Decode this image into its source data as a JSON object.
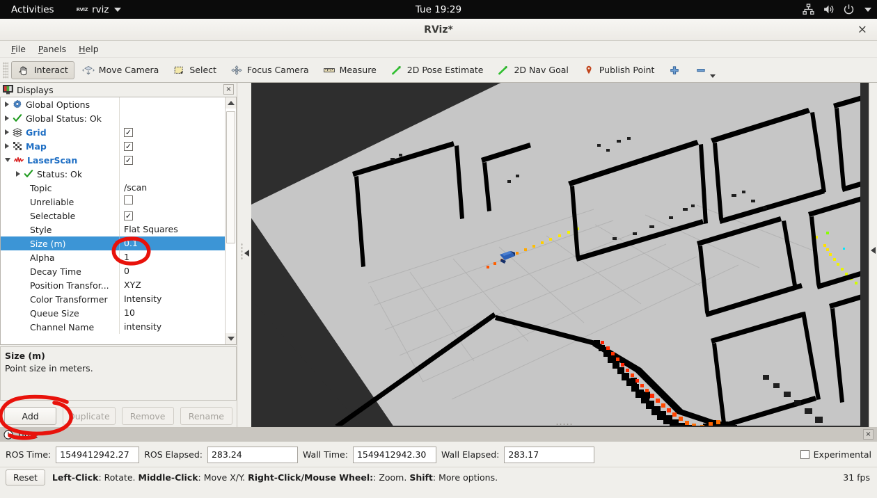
{
  "desktop": {
    "activities_label": "Activities",
    "app_icon_label": "RVIZ",
    "app_name": "rviz",
    "clock": "Tue 19:29",
    "tray_icons": [
      "network-icon",
      "volume-icon",
      "power-icon",
      "chevron-down-icon"
    ]
  },
  "window": {
    "title": "RViz*",
    "close_label": "×"
  },
  "menubar": {
    "items": [
      {
        "label": "File",
        "accel": "F"
      },
      {
        "label": "Panels",
        "accel": "P"
      },
      {
        "label": "Help",
        "accel": "H"
      }
    ]
  },
  "toolbar": {
    "items": [
      {
        "label": "Interact",
        "icon": "hand-cursor-icon",
        "active": true
      },
      {
        "label": "Move Camera",
        "icon": "move-camera-icon",
        "active": false
      },
      {
        "label": "Select",
        "icon": "select-box-icon",
        "active": false
      },
      {
        "label": "Focus Camera",
        "icon": "focus-camera-icon",
        "active": false
      },
      {
        "label": "Measure",
        "icon": "ruler-icon",
        "active": false
      },
      {
        "label": "2D Pose Estimate",
        "icon": "pose-arrow-icon",
        "active": false
      },
      {
        "label": "2D Nav Goal",
        "icon": "nav-goal-icon",
        "active": false
      },
      {
        "label": "Publish Point",
        "icon": "map-pin-icon",
        "active": false
      }
    ],
    "add_tool_icon": "plus-icon",
    "remove_tool_icon": "minus-icon",
    "remove_tool_dropdown_icon": "chevron-down-icon"
  },
  "displays_panel": {
    "title": "Displays",
    "icon": "displays-monitor-icon",
    "close_label": "×",
    "tree": [
      {
        "kind": "item",
        "indent": 0,
        "expander": "right",
        "icon": "gear-icon",
        "label": "Global Options",
        "style": "plain",
        "checkbox": null
      },
      {
        "kind": "item",
        "indent": 0,
        "expander": "right",
        "icon": "check-icon",
        "label": "Global Status: Ok",
        "style": "plain",
        "checkbox": null
      },
      {
        "kind": "item",
        "indent": 0,
        "expander": "right",
        "icon": "grid-icon",
        "label": "Grid",
        "style": "blue",
        "checkbox": true
      },
      {
        "kind": "item",
        "indent": 0,
        "expander": "right",
        "icon": "map-icon",
        "label": "Map",
        "style": "blue",
        "checkbox": true
      },
      {
        "kind": "item",
        "indent": 0,
        "expander": "down",
        "icon": "laserscan-icon",
        "label": "LaserScan",
        "style": "blue",
        "checkbox": true
      },
      {
        "kind": "item",
        "indent": 1,
        "expander": "right",
        "icon": "check-icon",
        "label": "Status: Ok",
        "style": "plain",
        "checkbox": null
      },
      {
        "kind": "prop",
        "label": "Topic",
        "value": "/scan",
        "value_type": "text"
      },
      {
        "kind": "prop",
        "label": "Unreliable",
        "value": false,
        "value_type": "checkbox"
      },
      {
        "kind": "prop",
        "label": "Selectable",
        "value": true,
        "value_type": "checkbox"
      },
      {
        "kind": "prop",
        "label": "Style",
        "value": "Flat Squares",
        "value_type": "text"
      },
      {
        "kind": "prop",
        "label": "Size (m)",
        "value": "0.1",
        "value_type": "text",
        "selected": true
      },
      {
        "kind": "prop",
        "label": "Alpha",
        "value": "1",
        "value_type": "text"
      },
      {
        "kind": "prop",
        "label": "Decay Time",
        "value": "0",
        "value_type": "text"
      },
      {
        "kind": "prop",
        "label": "Position Transfor...",
        "value": "XYZ",
        "value_type": "text"
      },
      {
        "kind": "prop",
        "label": "Color Transformer",
        "value": "Intensity",
        "value_type": "text"
      },
      {
        "kind": "prop",
        "label": "Queue Size",
        "value": "10",
        "value_type": "text"
      },
      {
        "kind": "prop",
        "label": "Channel Name",
        "value": "intensity",
        "value_type": "text"
      }
    ],
    "description": {
      "title": "Size (m)",
      "text": "Point size in meters."
    },
    "buttons": [
      {
        "label": "Add",
        "enabled": true
      },
      {
        "label": "Duplicate",
        "enabled": false
      },
      {
        "label": "Remove",
        "enabled": false
      },
      {
        "label": "Rename",
        "enabled": false
      }
    ]
  },
  "time_panel": {
    "title": "Time",
    "icon": "clock-icon",
    "close_label": "×",
    "fields": [
      {
        "label": "ROS Time:",
        "value": "1549412942.27"
      },
      {
        "label": "ROS Elapsed:",
        "value": "283.24"
      },
      {
        "label": "Wall Time:",
        "value": "1549412942.30"
      },
      {
        "label": "Wall Elapsed:",
        "value": "283.17"
      }
    ],
    "experimental_label": "Experimental",
    "experimental_checked": false
  },
  "statusbar": {
    "reset_label": "Reset",
    "hints": [
      {
        "bold": "Left-Click",
        "plain": ": Rotate."
      },
      {
        "bold": "Middle-Click",
        "plain": ": Move X/Y."
      },
      {
        "bold": "Right-Click/Mouse Wheel:",
        "plain": ": Zoom."
      },
      {
        "bold": "Shift",
        "plain": ": More options."
      }
    ],
    "fps": "31 fps"
  },
  "viewport": {
    "background_color": "#2e2e2e",
    "map_color": "#c6c6c6",
    "wall_color": "#000000",
    "grid_color": "#b5b5b5",
    "robot_marker_color": "#2c5fb5",
    "scan_colors": [
      "#ff1a00",
      "#ff7a00",
      "#ffd400",
      "#9dff00",
      "#00ffd0"
    ]
  },
  "annotations": {
    "color": "#e8120b",
    "circles": [
      "size-value-circle",
      "add-button-circle"
    ]
  }
}
